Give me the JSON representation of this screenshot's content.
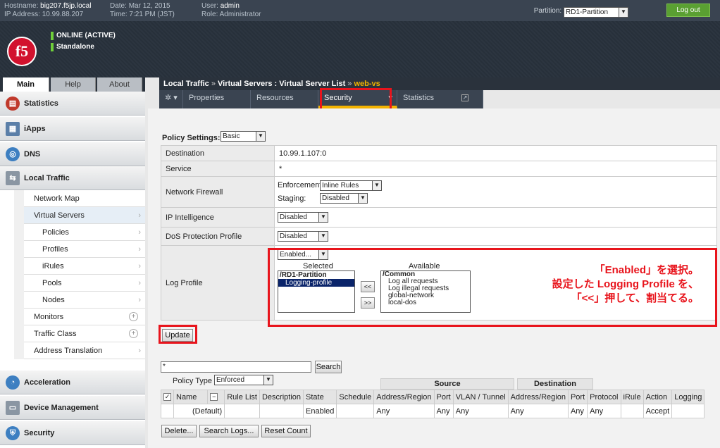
{
  "topbar": {
    "hostname_label": "Hostname:",
    "hostname": "big207.f5jp.local",
    "ip_label": "IP Address:",
    "ip": "10.99.88.207",
    "date_label": "Date:",
    "date": "Mar 12, 2015",
    "time_label": "Time:",
    "time": "7:21 PM (JST)",
    "user_label": "User:",
    "user": "admin",
    "role_label": "Role:",
    "role": "Administrator",
    "partition_label": "Partition:",
    "partition_value": "RD1-Partition",
    "logout": "Log out"
  },
  "brand": {
    "logo": "f5",
    "status1": "ONLINE (ACTIVE)",
    "status2": "Standalone"
  },
  "nav_tabs": [
    "Main",
    "Help",
    "About"
  ],
  "sidebar": {
    "categories": [
      {
        "label": "Statistics",
        "icon": "statistics-icon"
      },
      {
        "label": "iApps",
        "icon": "iapps-icon"
      },
      {
        "label": "DNS",
        "icon": "dns-icon"
      },
      {
        "label": "Local Traffic",
        "icon": "local-traffic-icon"
      },
      {
        "label": "Acceleration",
        "icon": "acceleration-icon"
      },
      {
        "label": "Device Management",
        "icon": "device-management-icon"
      },
      {
        "label": "Security",
        "icon": "security-icon"
      }
    ],
    "local_traffic_items": [
      "Network Map",
      "Virtual Servers",
      "Policies",
      "Profiles",
      "iRules",
      "Pools",
      "Nodes",
      "Monitors",
      "Traffic Class",
      "Address Translation"
    ]
  },
  "breadcrumb": {
    "part1": "Local Traffic",
    "sep": "»",
    "part2": "Virtual Servers : Virtual Server List",
    "current": "web-vs"
  },
  "tabs": [
    "Properties",
    "Resources",
    "Security",
    "Statistics"
  ],
  "policy_settings": {
    "label": "Policy Settings:",
    "value": "Basic"
  },
  "props": {
    "destination_k": "Destination",
    "destination_v": "10.99.1.107:0",
    "service_k": "Service",
    "service_v": "*",
    "firewall_k": "Network Firewall",
    "enforcement_label": "Enforcement:",
    "enforcement_value": "Inline Rules",
    "staging_label": "Staging:",
    "staging_value": "Disabled",
    "ipi_k": "IP Intelligence",
    "ipi_v": "Disabled",
    "dos_k": "DoS Protection Profile",
    "dos_v": "Disabled",
    "log_k": "Log Profile",
    "log_v": "Enabled...",
    "selected_label": "Selected",
    "available_label": "Available",
    "selected_group": "/RD1-Partition",
    "selected_item": "Logging-profile",
    "available_group": "/Common",
    "available_items": [
      "Log all requests",
      "Log illegal requests",
      "global-network",
      "local-dos"
    ],
    "move_left": "<<",
    "move_right": ">>"
  },
  "annotation": {
    "line1": "「Enabled」を選択。",
    "line2": "設定した Logging Profile を、",
    "line3": "「<<」押して、割当てる。"
  },
  "update": "Update",
  "search": {
    "value": "*",
    "button": "Search"
  },
  "policy_type": {
    "label": "Policy Type",
    "value": "Enforced"
  },
  "rules": {
    "group_source": "Source",
    "group_destination": "Destination",
    "headers": [
      "Name",
      "Rule List",
      "Description",
      "State",
      "Schedule",
      "Address/Region",
      "Port",
      "VLAN / Tunnel",
      "Address/Region",
      "Port",
      "Protocol",
      "iRule",
      "Action",
      "Logging"
    ],
    "row": [
      "(Default)",
      "",
      "",
      "Enabled",
      "",
      "Any",
      "Any",
      "Any",
      "Any",
      "Any",
      "Any",
      "",
      "Accept",
      ""
    ]
  },
  "bottom_buttons": [
    "Delete...",
    "Search Logs...",
    "Reset Count"
  ]
}
